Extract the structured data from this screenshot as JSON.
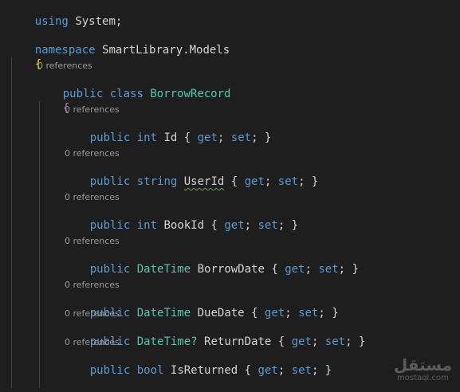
{
  "code": {
    "using_keyword": "using",
    "using_ns": "System",
    "using_semi": ";",
    "namespace_keyword": "namespace",
    "namespace_name": "SmartLibrary.Models",
    "open_brace_outer": "{",
    "class_lens": "0 references",
    "class_public": "public",
    "class_keyword": "class",
    "class_name": "BorrowRecord",
    "open_brace_class": "{",
    "properties": [
      {
        "lens": "0 references",
        "modifier": "public",
        "type": "int",
        "name": "Id",
        "accessors": "{ get; set; }"
      },
      {
        "lens": "0 references",
        "modifier": "public",
        "type": "string",
        "name": "UserId",
        "accessors": "{ get; set; }"
      },
      {
        "lens": "0 references",
        "modifier": "public",
        "type": "int",
        "name": "BookId",
        "accessors": "{ get; set; }"
      },
      {
        "lens": "0 references",
        "modifier": "public",
        "type": "DateTime",
        "name": "BorrowDate",
        "accessors": "{ get; set; }"
      },
      {
        "lens": "0 references",
        "modifier": "public",
        "type": "DateTime",
        "name": "DueDate",
        "accessors": "{ get; set; }"
      },
      {
        "lens": "0 references",
        "modifier": "public",
        "type": "DateTime?",
        "name": "ReturnDate",
        "accessors": "{ get; set; }"
      },
      {
        "lens": "0 references",
        "modifier": "public",
        "type": "bool",
        "name": "IsReturned",
        "accessors": "{ get; set; }"
      }
    ]
  },
  "watermark": {
    "arabic": "مستقل",
    "latin": "mostaql.com"
  },
  "colors": {
    "background": "#1e1e1e",
    "keyword": "#569cd6",
    "type": "#4ec9b0",
    "text": "#d4d4d4",
    "codelens": "#999999",
    "brace_outer": "#ffd700",
    "brace_class": "#da70d6"
  }
}
